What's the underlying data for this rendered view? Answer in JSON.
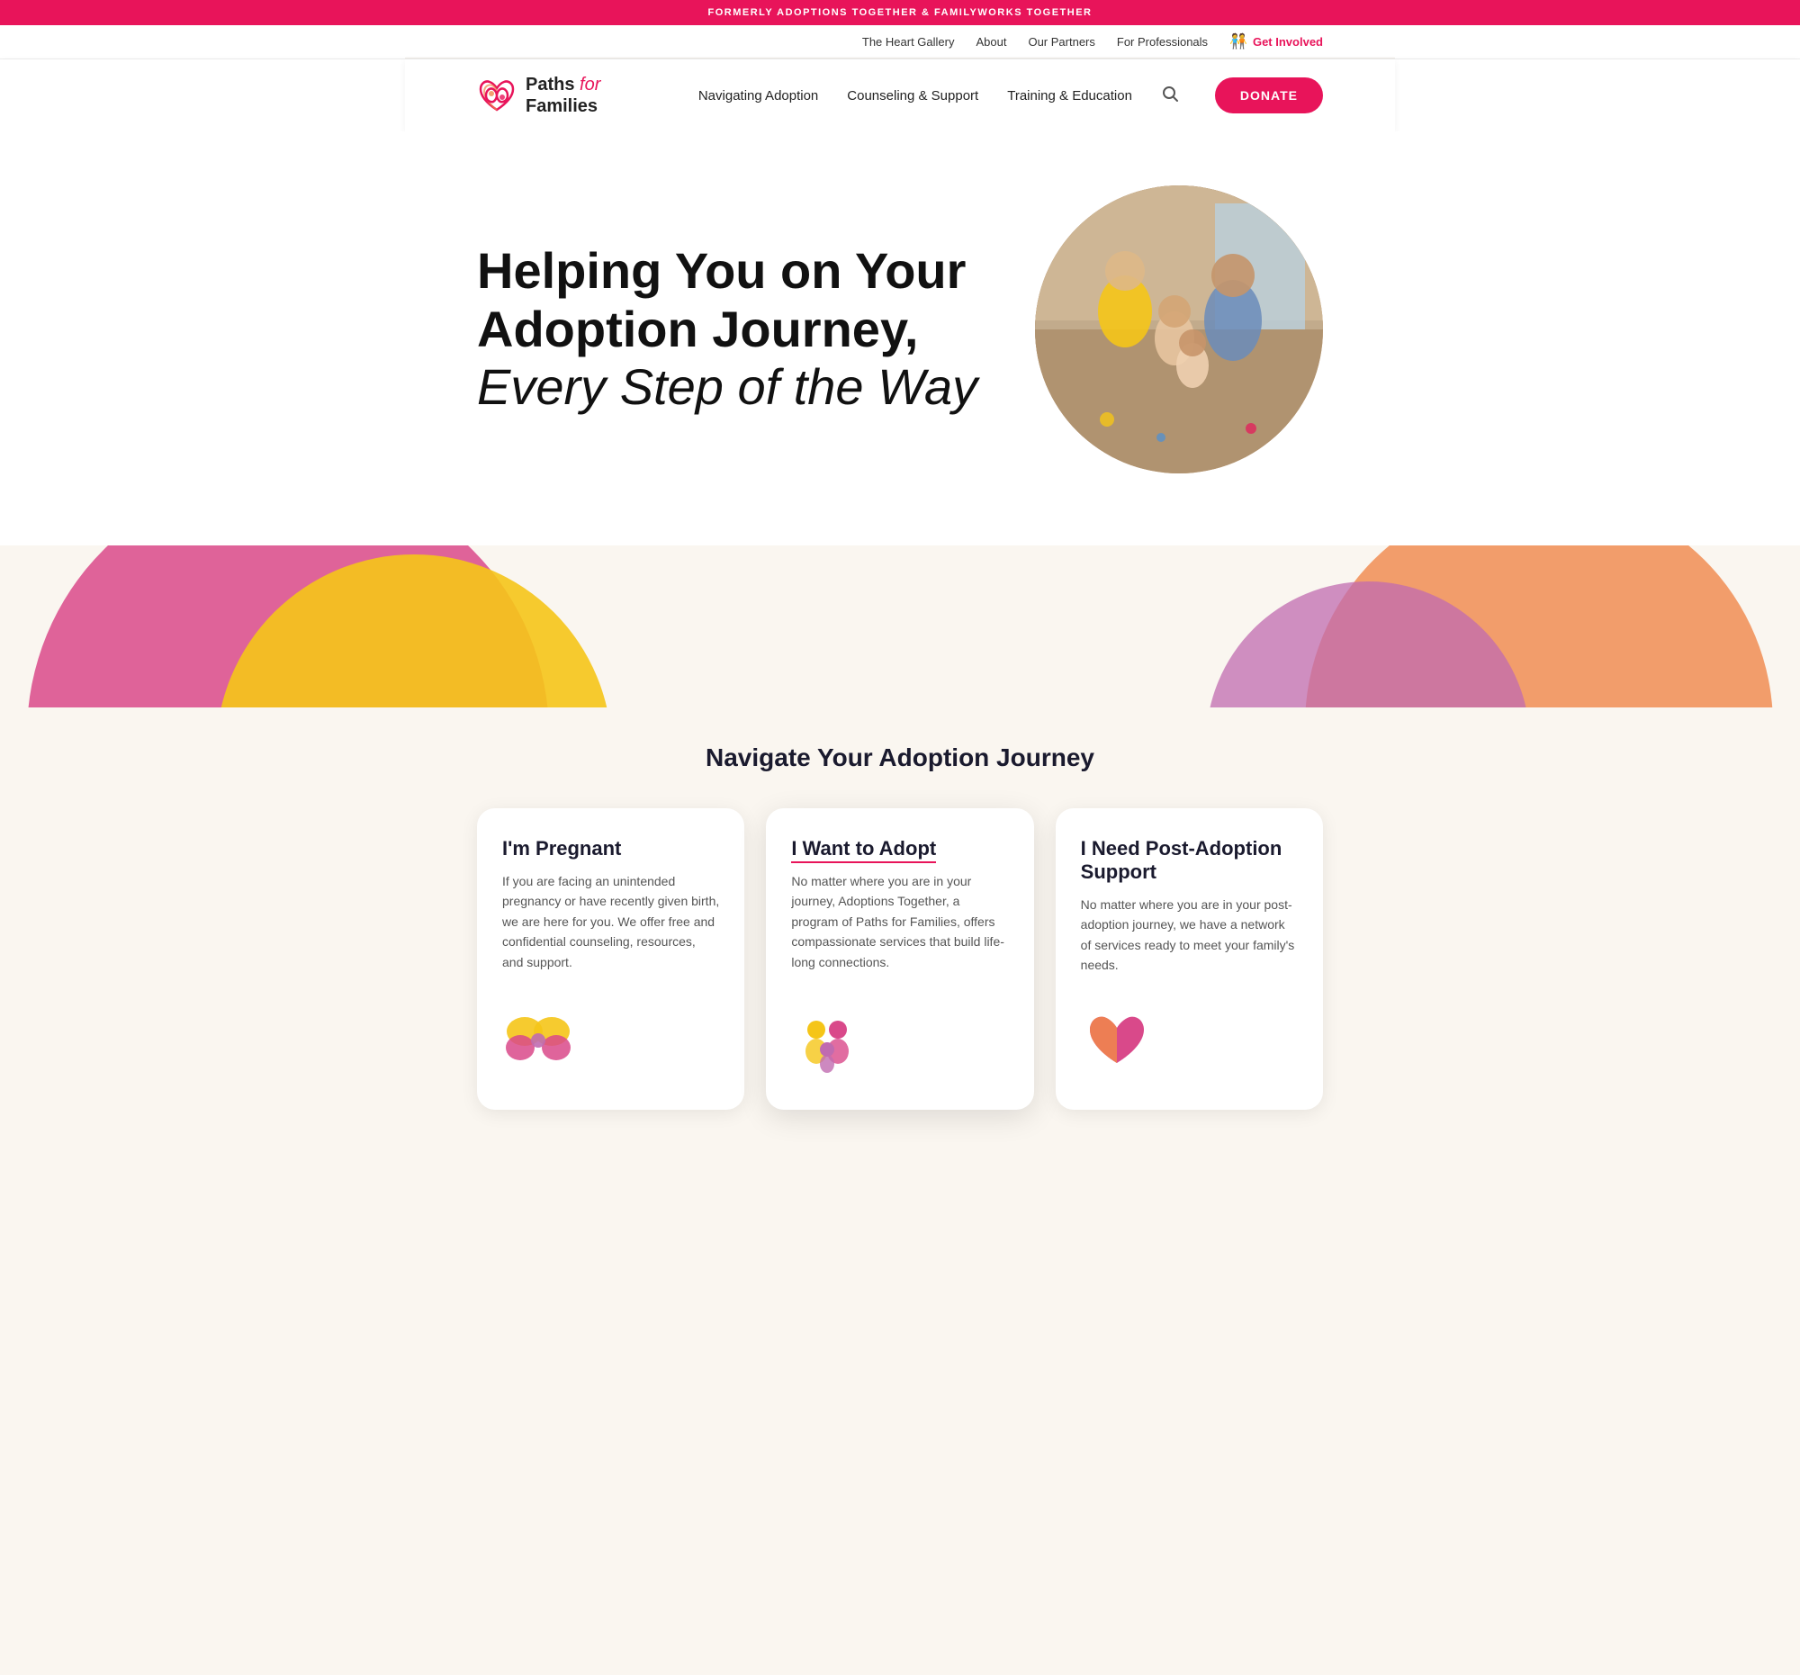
{
  "announcement": {
    "text": "FORMERLY ADOPTIONS TOGETHER & FAMILYWORKS TOGETHER"
  },
  "utility_nav": {
    "links": [
      {
        "label": "The Heart Gallery",
        "name": "heart-gallery-link"
      },
      {
        "label": "About",
        "name": "about-link"
      },
      {
        "label": "Our Partners",
        "name": "partners-link"
      },
      {
        "label": "For Professionals",
        "name": "professionals-link"
      },
      {
        "label": "Get Involved",
        "name": "get-involved-link"
      }
    ]
  },
  "main_nav": {
    "logo_paths": "Paths",
    "logo_for": "for",
    "logo_families": "Families",
    "links": [
      {
        "label": "Navigating Adoption",
        "name": "nav-navigating-adoption"
      },
      {
        "label": "Counseling & Support",
        "name": "nav-counseling-support"
      },
      {
        "label": "Training & Education",
        "name": "nav-training-education"
      }
    ],
    "donate_label": "DONATE"
  },
  "hero": {
    "headline_part1": "Helping You on Your",
    "headline_part2": "Adoption Journey,",
    "headline_italic": "Every Step of the Way"
  },
  "journey_section": {
    "heading": "Navigate Your Adoption Journey",
    "cards": [
      {
        "name": "pregnant-card",
        "title": "I'm Pregnant",
        "title_link": false,
        "description": "If you are facing an unintended pregnancy or have recently given birth, we are here for you. We offer free and confidential counseling, resources, and support.",
        "icon": "butterfly"
      },
      {
        "name": "adopt-card",
        "title": "I Want to Adopt",
        "title_link": true,
        "description": "No matter where you are in your journey, Adoptions Together, a program of Paths for Families, offers compassionate services that build life-long connections.",
        "icon": "family"
      },
      {
        "name": "post-adoption-card",
        "title": "I Need Post-Adoption Support",
        "title_link": false,
        "description": "No matter where you are in your post-adoption journey, we have a network of services ready to meet your family's needs.",
        "icon": "heart"
      }
    ]
  }
}
